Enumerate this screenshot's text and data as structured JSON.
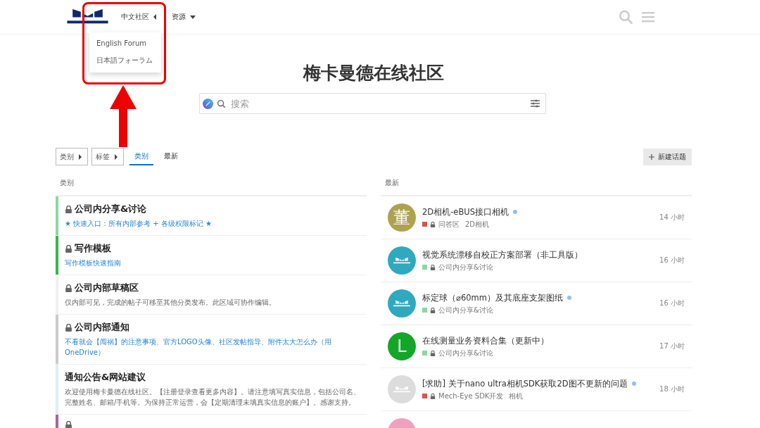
{
  "header": {
    "nav": [
      {
        "label": "中文社区",
        "expanded": true
      },
      {
        "label": "资源",
        "expanded": false
      }
    ],
    "dropdown": [
      "English Forum",
      "日本語フォーラム"
    ]
  },
  "title": "梅卡曼德在线社区",
  "search": {
    "placeholder": "搜索"
  },
  "filters": [
    {
      "label": "类别"
    },
    {
      "label": "标签"
    }
  ],
  "tabs": [
    {
      "label": "类别",
      "selected": true
    },
    {
      "label": "最新",
      "selected": false
    }
  ],
  "new_topic_button": "新建话题",
  "categories": {
    "heading": "类别",
    "items": [
      {
        "name": "公司内分享&讨论",
        "locked": true,
        "color": "#8ad9a2",
        "description": "★ 快速入口：所有内部参考 + 各级权限标记 ★",
        "kind": "link"
      },
      {
        "name": "写作模板",
        "locked": true,
        "color": "#3ab54a",
        "description": "写作模板快速指南",
        "kind": "link"
      },
      {
        "name": "公司内部草稿区",
        "locked": true,
        "color": "#f0f0f0",
        "description": "仅内部可见，完成的帖子可移至其他分类发布。此区域可协作编辑。",
        "kind": "plain"
      },
      {
        "name": "公司内部通知",
        "locked": true,
        "color": "#cccccc",
        "description": "不看就会【闯祸】的注意事项、官方LOGO头像、社区发帖指导、附件太大怎么办（用OneDrive）",
        "kind": "link"
      },
      {
        "name": "通知公告&网站建议",
        "locked": false,
        "color": "#dbeefc",
        "description": "欢迎使用梅卡曼德在线社区。【注册登录查看更多内容】。请注意填写真实信息，包括公司名、完整姓名、邮箱/手机等。为保持正常运营，会【定期清理未填真实信息的账户】。感谢支持。",
        "kind": "plain"
      },
      {
        "locked": true,
        "color": "#b0619b",
        "kind": "partial"
      }
    ]
  },
  "latest": {
    "heading": "最新",
    "topics": [
      {
        "avatar": {
          "kind": "letter",
          "text": "董",
          "color": "#ada250"
        },
        "title": "2D相机-eBUS接口相机",
        "unread": true,
        "category": {
          "label": "问答区",
          "color": "#d9534f"
        },
        "tag": "2D相机",
        "time": "14 小时"
      },
      {
        "avatar": {
          "kind": "logo",
          "color": "#2fa9bd"
        },
        "title": "视觉系统漂移自校正方案部署（非工具版）",
        "unread": false,
        "category": {
          "label": "公司内分享&讨论",
          "color": "#8ad9a2"
        },
        "time": "16 小时"
      },
      {
        "avatar": {
          "kind": "logo",
          "color": "#2fa9bd"
        },
        "title": "标定球（⌀60mm）及其底座支架图纸",
        "unread": true,
        "category": {
          "label": "公司内分享&讨论",
          "color": "#8ad9a2"
        },
        "time": "16 小时"
      },
      {
        "avatar": {
          "kind": "letter",
          "text": "L",
          "color": "#14a628"
        },
        "title": "在线测量业务资料合集（更新中）",
        "unread": false,
        "category": {
          "label": "公司内分享&讨论",
          "color": "#8ad9a2"
        },
        "time": "17 小时"
      },
      {
        "avatar": {
          "kind": "logo",
          "color": "#dcdcdc"
        },
        "title": "[求助] 关于nano ultra相机SDK获取2D图不更新的问题",
        "unread": true,
        "category": {
          "label": "Mech-Eye SDK开发",
          "color": "#d9534f"
        },
        "tag": "相机",
        "time": "18 小时"
      },
      {
        "avatar": {
          "kind": "partial",
          "color": "#f0a0c0"
        }
      }
    ]
  }
}
